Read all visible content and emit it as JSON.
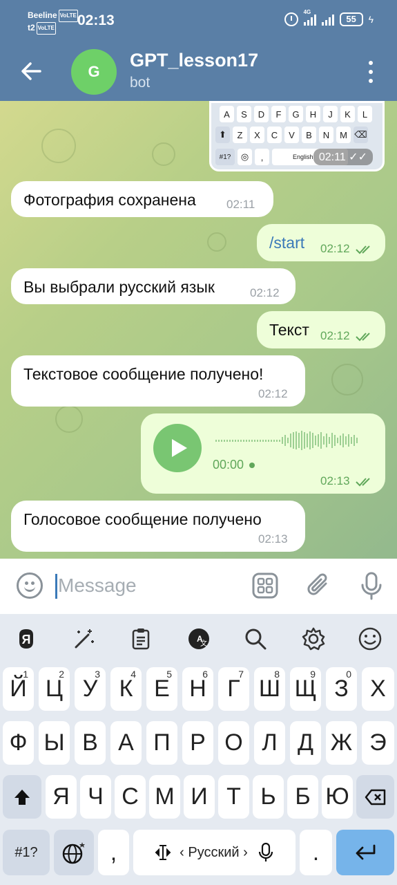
{
  "status_bar": {
    "carrier1": "Beeline",
    "carrier2": "t2",
    "volte": "VoLTE",
    "time": "02:13",
    "network": "4G",
    "battery": "55"
  },
  "header": {
    "avatar_letter": "G",
    "title": "GPT_lesson17",
    "subtitle": "bot"
  },
  "screenshot_preview": {
    "row1": [
      "A",
      "S",
      "D",
      "F",
      "G",
      "H",
      "J",
      "K",
      "L"
    ],
    "row2": [
      "Z",
      "X",
      "C",
      "V",
      "B",
      "N",
      "M"
    ],
    "row3": [
      "#1?",
      ",",
      "English"
    ],
    "time": "02:11"
  },
  "messages": [
    {
      "dir": "in",
      "text": "Фотография сохранена",
      "time": "02:11"
    },
    {
      "dir": "out",
      "text": "/start",
      "time": "02:12"
    },
    {
      "dir": "in",
      "text": "Вы выбрали русский язык",
      "time": "02:12"
    },
    {
      "dir": "out",
      "text": "Текст",
      "time": "02:12"
    },
    {
      "dir": "in",
      "text": "Текстовое сообщение получено!",
      "time": "02:12"
    },
    {
      "dir": "out",
      "type": "voice",
      "duration": "00:00",
      "time": "02:13"
    },
    {
      "dir": "in",
      "text": "Голосовое сообщение получено",
      "time": "02:13"
    }
  ],
  "input": {
    "placeholder": "Message"
  },
  "keyboard": {
    "row1": [
      {
        "k": "Й",
        "h": "1"
      },
      {
        "k": "Ц",
        "h": "2"
      },
      {
        "k": "У",
        "h": "3"
      },
      {
        "k": "К",
        "h": "4"
      },
      {
        "k": "Е",
        "h": "5"
      },
      {
        "k": "Н",
        "h": "6"
      },
      {
        "k": "Г",
        "h": "7"
      },
      {
        "k": "Ш",
        "h": "8"
      },
      {
        "k": "Щ",
        "h": "9"
      },
      {
        "k": "З",
        "h": "0"
      },
      {
        "k": "Х",
        "h": ""
      }
    ],
    "row2": [
      "Ф",
      "Ы",
      "В",
      "А",
      "П",
      "Р",
      "О",
      "Л",
      "Д",
      "Ж",
      "Э"
    ],
    "row3": [
      "Я",
      "Ч",
      "С",
      "М",
      "И",
      "Т",
      "Ь",
      "Б",
      "Ю"
    ],
    "symbols": "#1?",
    "comma": ",",
    "period": ".",
    "language": "Русский"
  },
  "colors": {
    "header": "#5a7fa6",
    "outgoing_bubble": "#eefed9",
    "accent_green": "#60a75a",
    "enter_key": "#76b4ea"
  }
}
